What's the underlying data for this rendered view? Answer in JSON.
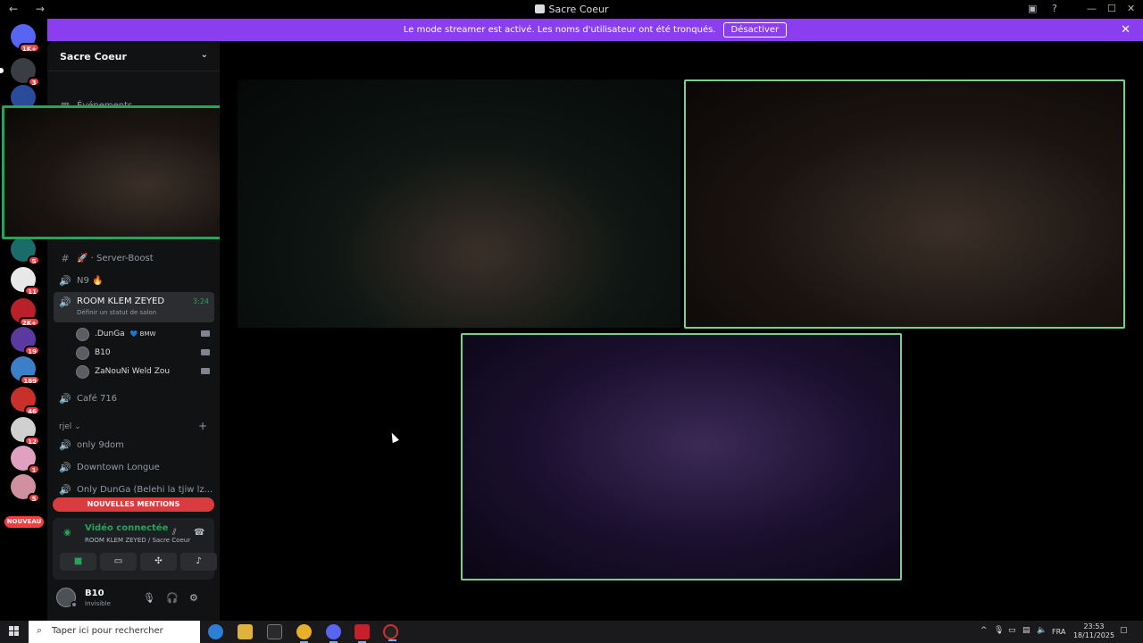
{
  "window": {
    "title": "Sacre Coeur",
    "nav_arrows": "← →",
    "controls": {
      "minimize": "—",
      "maximize": "☐",
      "close": "✕"
    }
  },
  "banner": {
    "text": "Le mode streamer est activé. Les noms d'utilisateur ont été tronqués.",
    "button": "Désactiver",
    "close": "✕"
  },
  "guilds": {
    "badges": [
      "1K+",
      "3",
      "5",
      "11",
      "2K+",
      "19",
      "189",
      "46",
      "12",
      "1",
      "5"
    ],
    "new_label": "NOUVEAU"
  },
  "sidebar": {
    "server_name": "Sacre Coeur",
    "events_label": "Événements",
    "channels": [
      {
        "icon": "#",
        "label": "🚀 · Server-Boost"
      },
      {
        "icon": "🔊",
        "label": "N9 🔥"
      }
    ],
    "active_channel": {
      "label": "ROOM KLEM ZEYED",
      "time": "3:24",
      "status_hint": "Définir un statut de salon"
    },
    "voice_users": [
      {
        "name": ".DunGa",
        "tag": "💙 BMW"
      },
      {
        "name": "B10",
        "tag": ""
      },
      {
        "name": "ZaNouNi Weld Zou",
        "tag": ""
      }
    ],
    "more_channels": [
      {
        "icon": "🔊",
        "label": "Café 716"
      }
    ],
    "category": "rjel",
    "category_channels": [
      {
        "icon": "🔊",
        "label": "only 9dom"
      },
      {
        "icon": "🔊",
        "label": "Downtown Longue"
      },
      {
        "icon": "🔊",
        "label": "Only DunGa (Belehi la tjiw lz..."
      }
    ],
    "mentions_label": "NOUVELLES MENTIONS"
  },
  "voice_panel": {
    "status": "Vidéo connectée",
    "location": "ROOM KLEM ZEYED / Sacre Coeur"
  },
  "user": {
    "name": "B10",
    "status": "Invisible"
  },
  "taskbar": {
    "search_placeholder": "Taper ici pour rechercher",
    "language": "FRA",
    "time": "23:53",
    "date": "18/11/2025"
  }
}
